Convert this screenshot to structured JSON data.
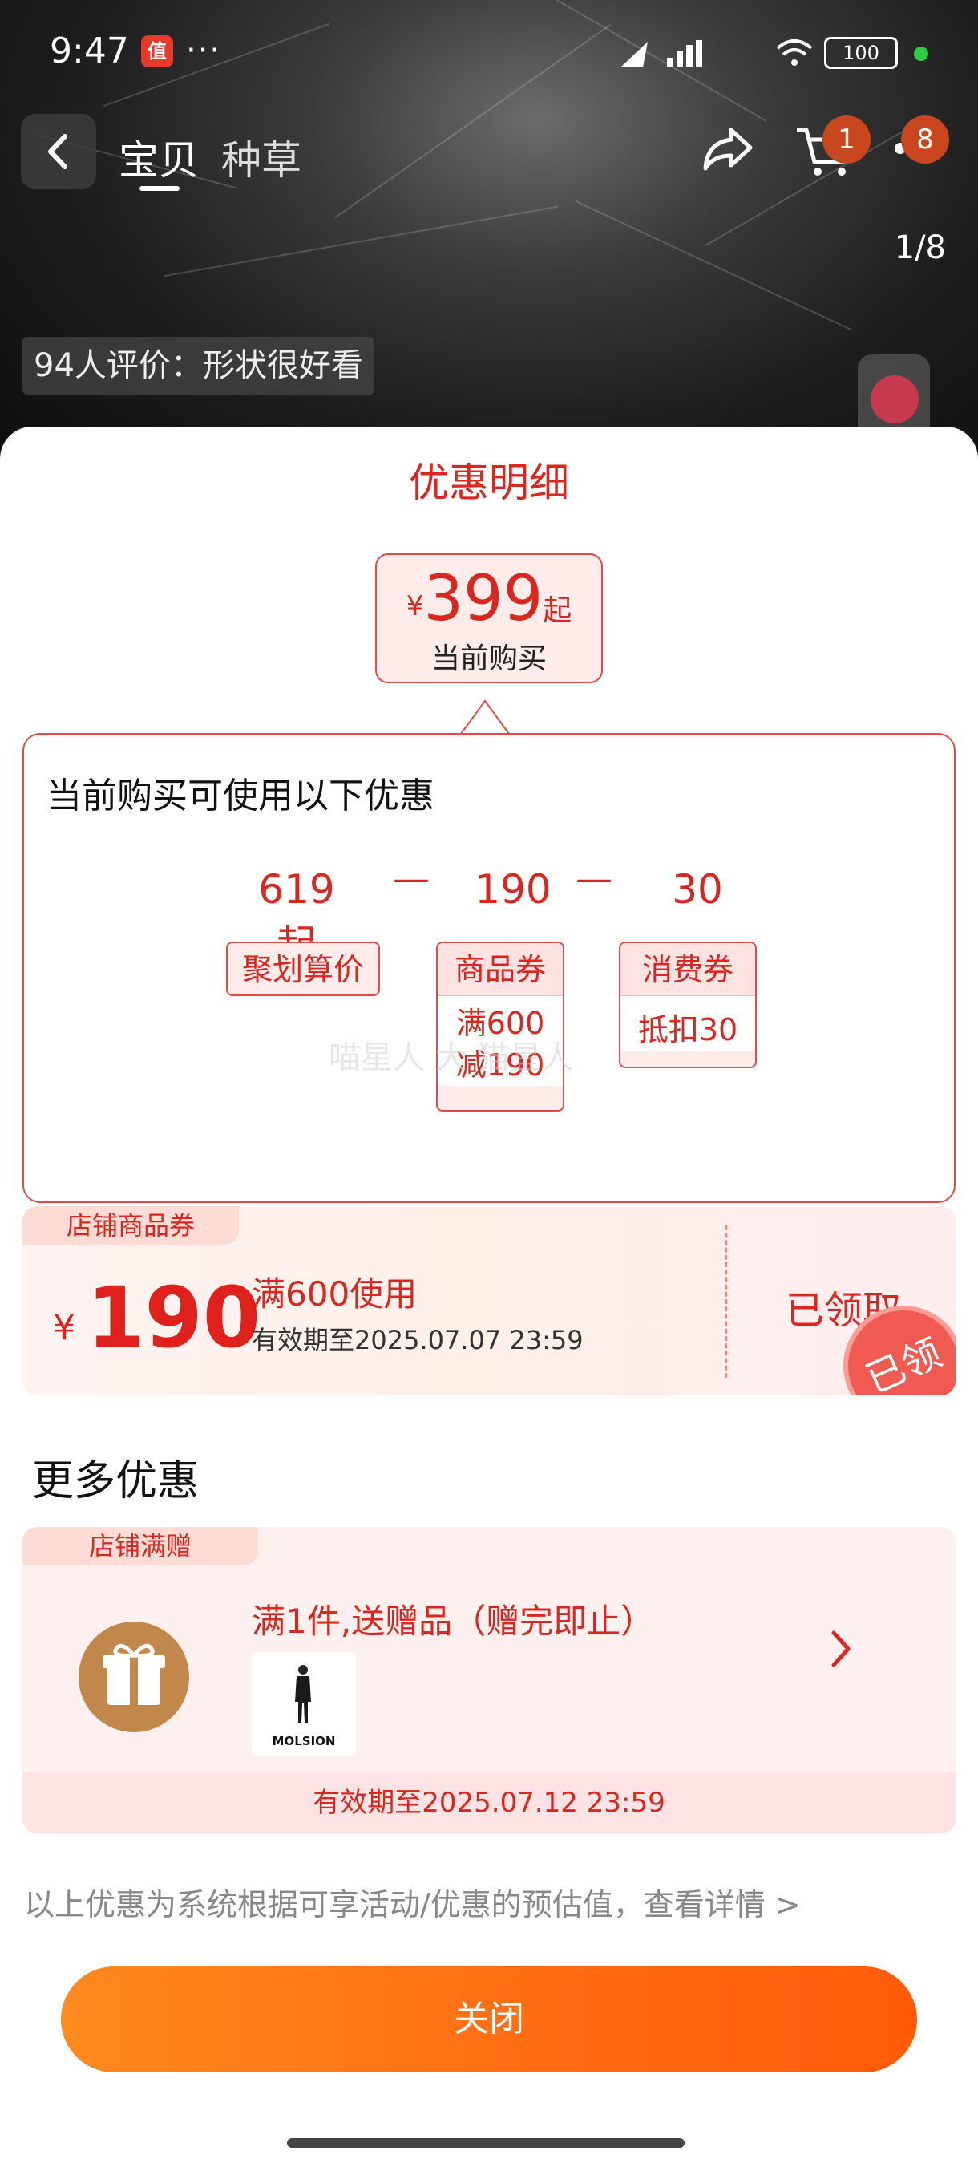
{
  "status_bar": {
    "time": "9:47",
    "app_icon_text": "值",
    "more": "···",
    "battery": "100"
  },
  "nav": {
    "back_icon": "back-chevron-icon",
    "tabs": [
      {
        "label": "宝贝",
        "active": true
      },
      {
        "label": "种草",
        "active": false
      }
    ],
    "cart_badge": "1",
    "message_badge": "8"
  },
  "gallery": {
    "page_indicator": "1/8",
    "review_summary": "94人评价：形状很好看"
  },
  "sheet": {
    "title": "优惠明细",
    "price": {
      "currency": "¥",
      "amount": "399",
      "suffix": "起",
      "label": "当前购买"
    },
    "calc": {
      "title": "当前购买可使用以下优惠",
      "items": [
        {
          "amount": "619起",
          "tag": "聚划算价",
          "detail": []
        },
        {
          "amount": "190",
          "tag": "商品券",
          "detail": [
            "满600",
            "减190"
          ]
        },
        {
          "amount": "30",
          "tag": "消费券",
          "detail": [
            "抵扣30"
          ]
        }
      ],
      "operator": "—"
    },
    "watermark": "喵星人 大 猫星人",
    "store_coupon": {
      "tag": "店铺商品券",
      "currency": "¥",
      "amount": "190",
      "condition": "满600使用",
      "validity": "有效期至2025.07.07 23:59",
      "status": "已领取",
      "stamp": "已领"
    },
    "more_title": "更多优惠",
    "gift": {
      "tag": "店铺满赠",
      "title": "满1件,送赠品（赠完即止）",
      "brand": "MOLSION",
      "validity": "有效期至2025.07.12 23:59"
    },
    "disclaimer": "以上优惠为系统根据可享活动/优惠的预估值，查看详情 >",
    "close_label": "关闭"
  },
  "colors": {
    "accent_red": "#d9271f",
    "button_orange": "#ff6a12",
    "gift_icon": "#c2874a"
  }
}
